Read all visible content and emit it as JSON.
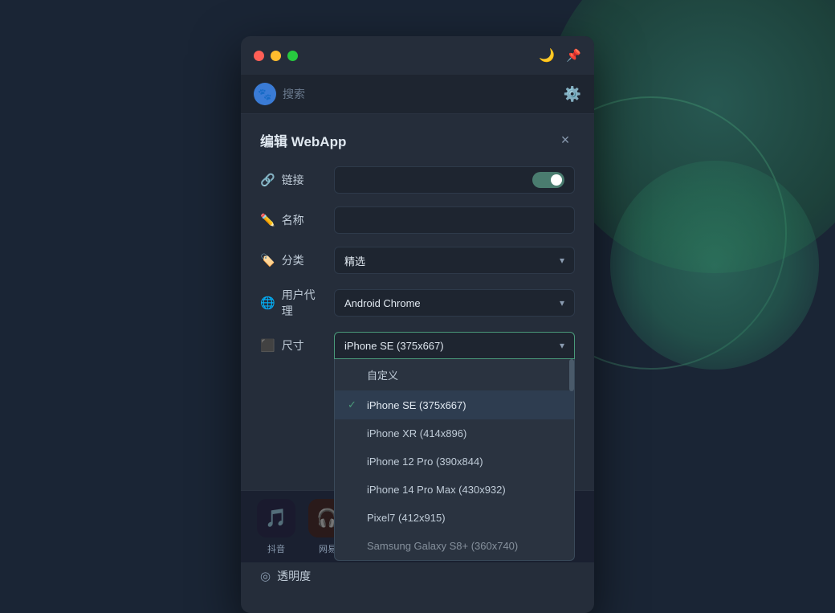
{
  "window": {
    "controls": {
      "red": "red-button",
      "yellow": "yellow-button",
      "green": "green-button"
    },
    "titlebar_actions": {
      "moon": "🌙",
      "pin": "🔌"
    }
  },
  "search": {
    "icon": "🐾",
    "placeholder": "搜索",
    "settings_icon": "⚙"
  },
  "dialog": {
    "title": "编辑 WebApp",
    "close": "×",
    "fields": {
      "link": {
        "label_icon": "🔗",
        "label": "链接"
      },
      "name": {
        "label_icon": "✏",
        "label": "名称"
      },
      "category": {
        "label_icon": "🏷",
        "label": "分类",
        "value": "精选"
      },
      "user_agent": {
        "label_icon": "🌐",
        "label": "用户代理",
        "value": "Android Chrome"
      },
      "size": {
        "label_icon": "⬛",
        "label": "尺寸",
        "value": "iPhone SE (375x667)"
      },
      "transparency": {
        "label_icon": "◎",
        "label": "透明度"
      }
    }
  },
  "size_dropdown": {
    "options": [
      {
        "label": "自定义",
        "selected": false
      },
      {
        "label": "iPhone SE (375x667)",
        "selected": true
      },
      {
        "label": "iPhone XR (414x896)",
        "selected": false
      },
      {
        "label": "iPhone 12 Pro (390x844)",
        "selected": false
      },
      {
        "label": "iPhone 14 Pro Max (430x932)",
        "selected": false
      },
      {
        "label": "Pixel7 (412x915)",
        "selected": false
      },
      {
        "label": "Samsung Galaxy S8+ (360x740)",
        "selected": false
      }
    ]
  },
  "bottom_apps": [
    {
      "icon": "🎵",
      "label": "抖音"
    },
    {
      "icon": "🎧",
      "label": "网易"
    }
  ]
}
